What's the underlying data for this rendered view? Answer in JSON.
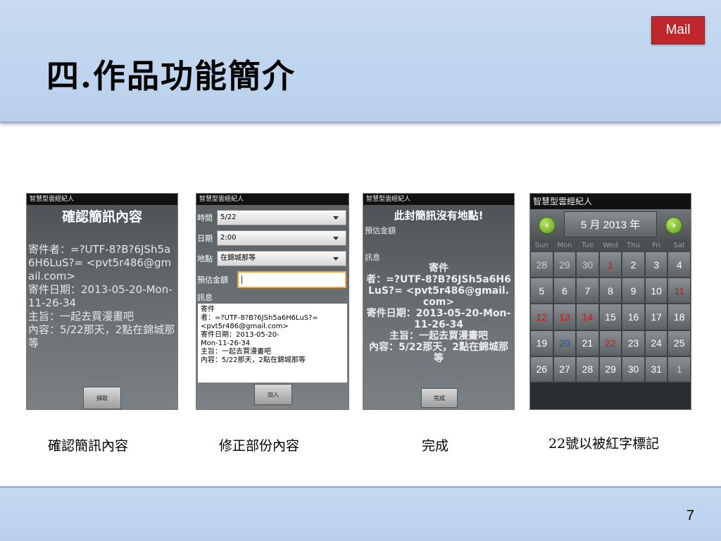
{
  "header": {
    "title": "四.作品功能簡介",
    "mail_label": "Mail"
  },
  "footer": {
    "page_number": "7"
  },
  "captions": [
    "確認簡訊內容",
    "修正部份內容",
    "完成",
    "22號以被紅字標記"
  ],
  "screen1": {
    "status_title": "智慧型雲經紀人",
    "heading": "確認簡訊內容",
    "lines": [
      "寄件者：=?UTF-8?B?6JSh5a6H6LuS?= <pvt5r486@gmail.com>",
      "寄件日期：2013-05-20-Mon-11-26-34",
      "主旨：一起去買漫畫吧",
      "內容：5/22那天，2點在錦城那等"
    ],
    "button": "擷取"
  },
  "screen2": {
    "status_title": "智慧型雲經紀人",
    "labels": {
      "time": "時間",
      "date": "日期",
      "place": "地點",
      "amount": "預估金額",
      "message": "訊息"
    },
    "values": {
      "time": "5/22",
      "date": "2:00",
      "place": "在錦城那等"
    },
    "message_lines": [
      "寄件",
      "者：=?UTF-8?B?6JSh5a6H6LuS?=",
      "<pvt5r486@gmail.com>",
      "寄件日期：2013-05-20-",
      "Mon-11-26-34",
      "主旨：一起去買漫畫吧",
      "內容：5/22那天，2點在錦城那等"
    ],
    "button": "加入"
  },
  "screen3": {
    "status_title": "智慧型雲經紀人",
    "heading": "此封簡訊沒有地點!",
    "amount_label": "預估金額",
    "message_label": "訊息",
    "lines": [
      "寄件",
      "者：=?UTF-8?B?6JSh5a6H6LuS?= <pvt5r486@gmail.com>",
      "寄件日期：2013-05-20-Mon-11-26-34",
      "主旨：一起去買漫畫吧",
      "內容：5/22那天，2點在錦城那等"
    ],
    "button": "完成"
  },
  "calendar": {
    "status_title": "智慧型雲經紀人",
    "month_label": "5 月 2013 年",
    "weekdays": [
      "Sun",
      "Mon",
      "Tue",
      "Wed",
      "Thu",
      "Fri",
      "Sat"
    ],
    "days": [
      "28",
      "29",
      "30",
      "1",
      "2",
      "3",
      "4",
      "5",
      "6",
      "7",
      "8",
      "9",
      "10",
      "11",
      "12",
      "13",
      "14",
      "15",
      "16",
      "17",
      "18",
      "19",
      "20",
      "21",
      "22",
      "23",
      "24",
      "25",
      "26",
      "27",
      "28",
      "29",
      "30",
      "31",
      "1"
    ],
    "dim_indices": [
      0,
      1,
      2,
      34
    ],
    "red_indices": [
      3,
      13,
      14,
      15,
      16,
      24
    ],
    "highlight_indices": [
      22
    ],
    "colors": {
      "red": "#d11515",
      "highlight": "#1c4fa0"
    }
  }
}
